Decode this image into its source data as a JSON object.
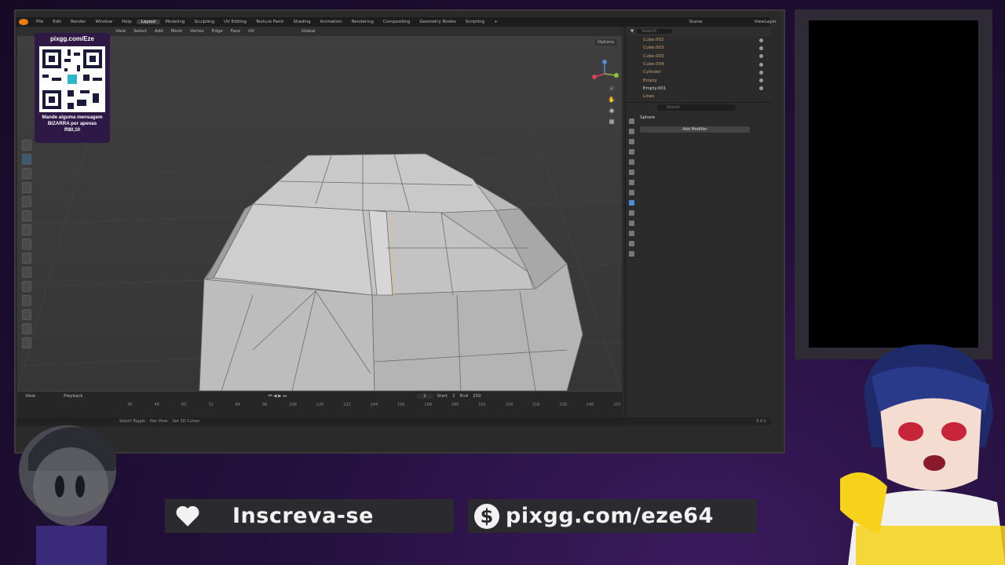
{
  "topbar": {
    "menus": [
      "File",
      "Edit",
      "Render",
      "Window",
      "Help"
    ],
    "workspaces": [
      "Layout",
      "Modeling",
      "Sculpting",
      "UV Editing",
      "Texture Paint",
      "Shading",
      "Animation",
      "Rendering",
      "Compositing",
      "Geometry Nodes",
      "Scripting"
    ],
    "active_workspace": "Layout",
    "add_tab": "+",
    "scene": "Scene",
    "view_layer": "ViewLayer"
  },
  "viewport_header": {
    "items": [
      "View",
      "Select",
      "Add",
      "Mesh",
      "Vertex",
      "Edge",
      "Face",
      "UV"
    ],
    "orientation": "Global",
    "options": "Options"
  },
  "outliner": {
    "search_placeholder": "Search",
    "items": [
      "Cube.002",
      "Cube.003",
      "Cube.003",
      "Cube.004",
      "Cylinder",
      "Empty",
      "Empty.001",
      "Lines"
    ]
  },
  "properties": {
    "search_placeholder": "Search",
    "object": "Sphere",
    "add_modifier": "Add Modifier"
  },
  "timeline": {
    "playback": "Playback",
    "view": "View",
    "current_frame": "1",
    "start_label": "Start",
    "start": "1",
    "end_label": "End",
    "end": "250",
    "ruler": [
      "36",
      "48",
      "60",
      "72",
      "84",
      "96",
      "108",
      "120",
      "132",
      "144",
      "156",
      "168",
      "180",
      "192",
      "204",
      "216",
      "228",
      "240",
      "252"
    ]
  },
  "statusbar": {
    "items": [
      "Select Toggle",
      "Pan View",
      "Set 3D Cursor"
    ],
    "version": "5.0.1"
  },
  "qr_card": {
    "title": "pixgg.com/Eze",
    "message_line1": "Mande alguma mensagem",
    "message_line2": "BIZARRA por apenas",
    "message_line3": "R$0,10"
  },
  "banners": {
    "subscribe": "Inscreva-se",
    "donate_symbol": "$",
    "donate": "pixgg.com/eze64"
  },
  "colors": {
    "accent": "#e87d0d",
    "background": "#1f0d33",
    "banner": "#2a2a2f"
  }
}
